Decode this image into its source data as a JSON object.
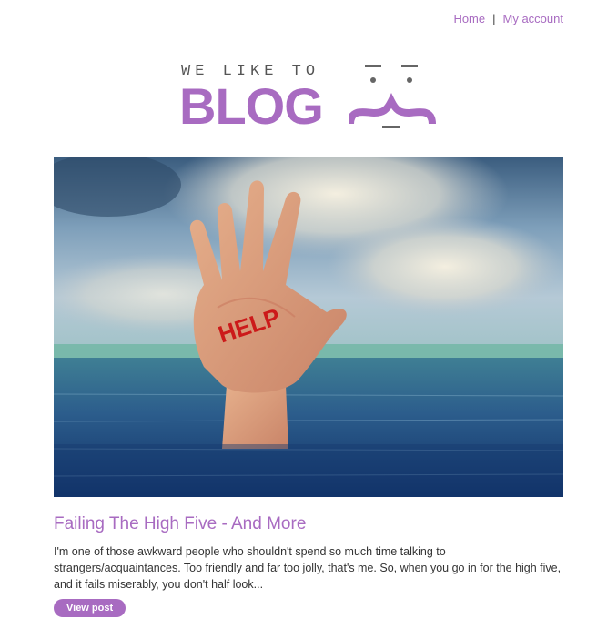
{
  "nav": {
    "home": "Home",
    "separator": "|",
    "my_account": "My account"
  },
  "logo": {
    "tagline": "WE LIKE TO",
    "word": "BLOG"
  },
  "post": {
    "image_alt_text_on_palm": "HELP",
    "title": "Failing The High Five - And More",
    "excerpt": "I'm one of those awkward people who shouldn't spend so much time talking to strangers/acquaintances. Too friendly and far too jolly, that's me. So, when you go in for the high five, and it fails miserably, you don't half look...",
    "button_label": "View post"
  },
  "colors": {
    "accent": "#a86bc1",
    "text": "#333333"
  }
}
